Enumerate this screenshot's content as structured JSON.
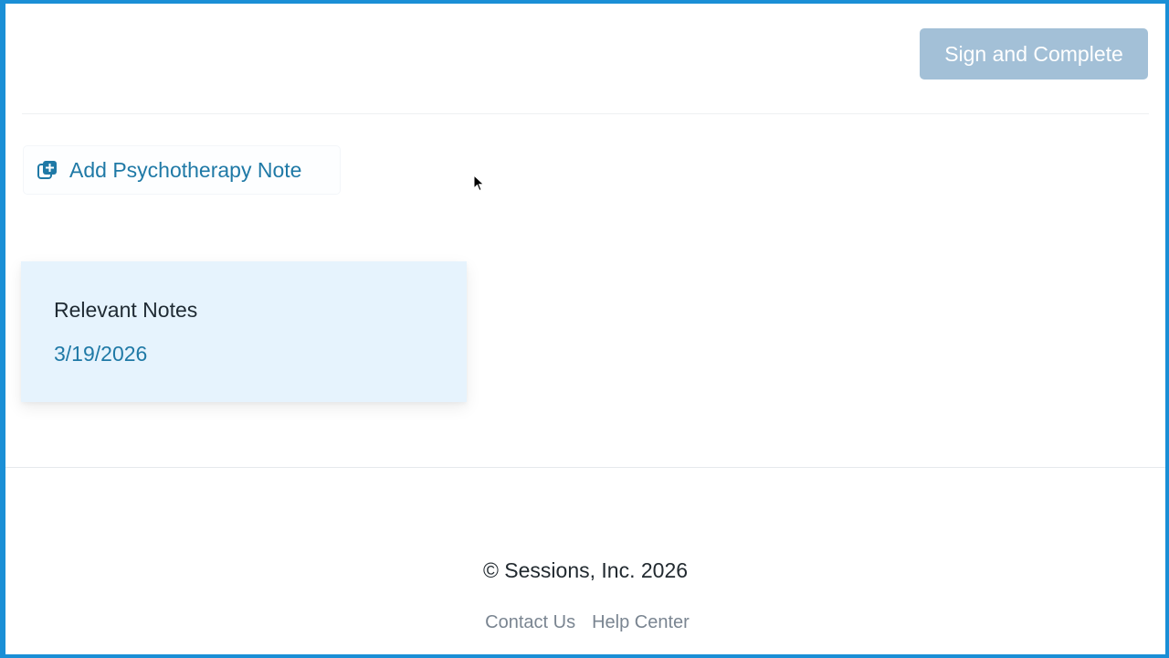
{
  "header": {
    "sign_button_label": "Sign and Complete"
  },
  "actions": {
    "add_note_label": "Add Psychotherapy Note",
    "add_note_icon": "add-note-icon"
  },
  "relevant_notes": {
    "title": "Relevant Notes",
    "items": [
      "3/19/2026"
    ]
  },
  "footer": {
    "copyright": "© Sessions, Inc. 2026",
    "links": [
      "Contact Us",
      "Help Center"
    ]
  },
  "colors": {
    "frame_border": "#1a8fd6",
    "primary_disabled": "#a3c0d7",
    "link": "#1f79a6",
    "card_bg": "#e6f3fd"
  }
}
